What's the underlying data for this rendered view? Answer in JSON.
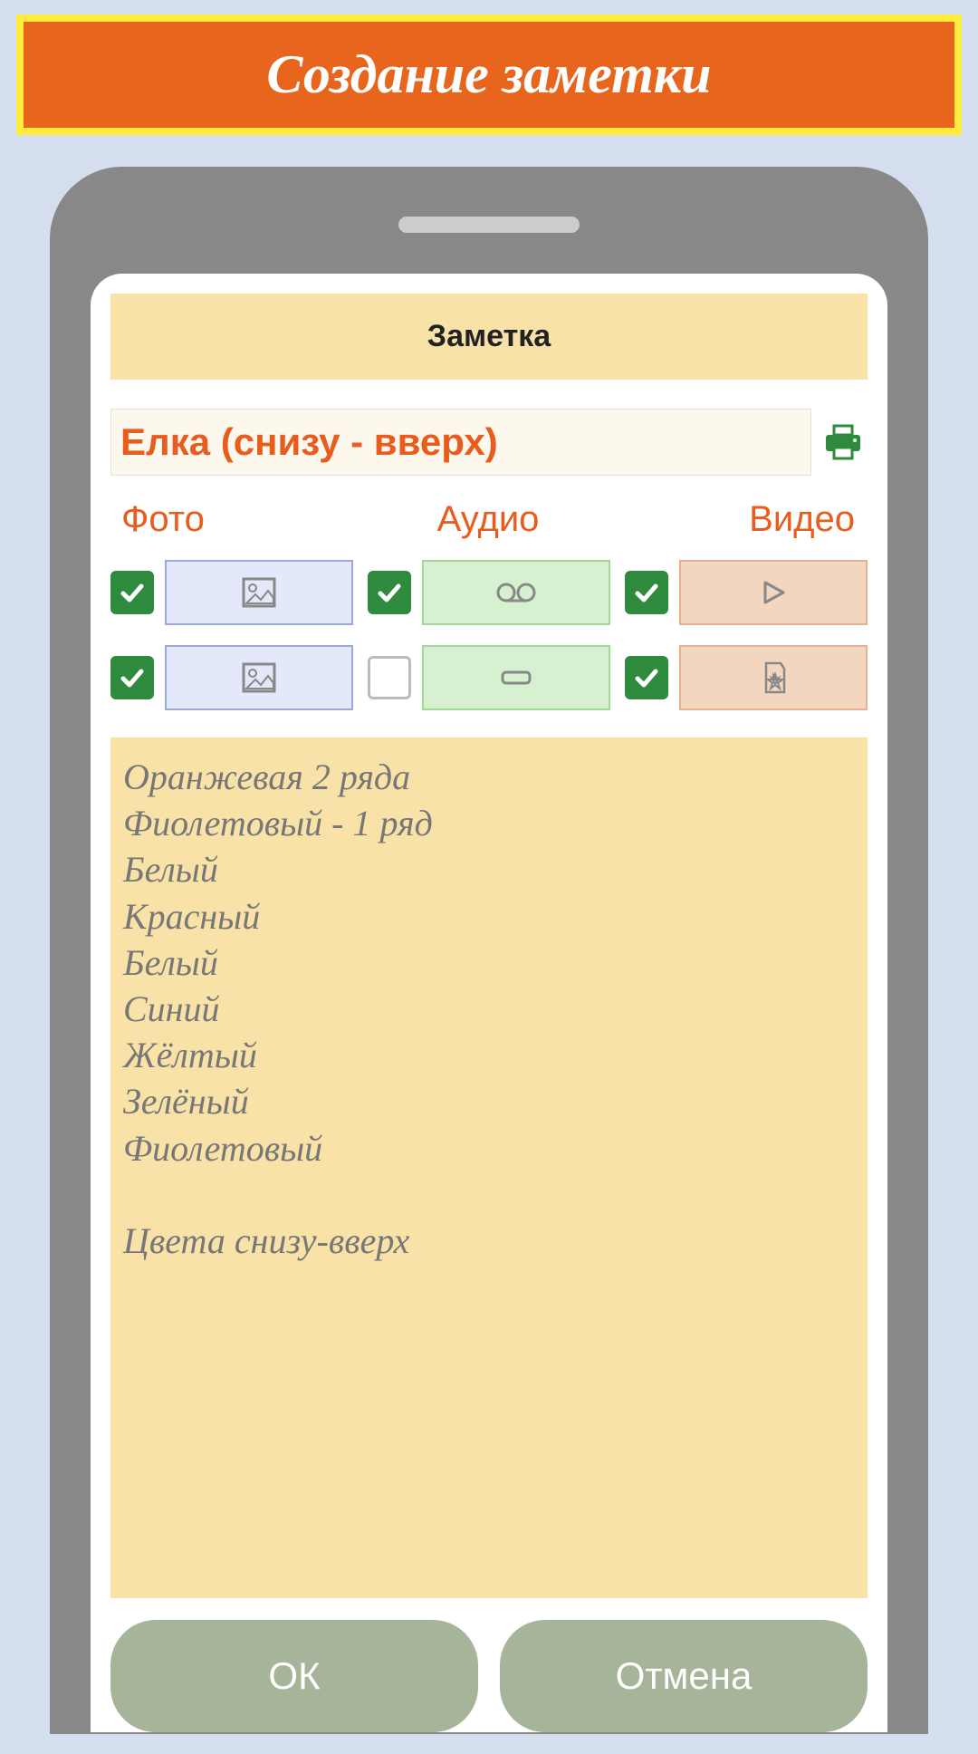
{
  "banner": {
    "title": "Создание заметки"
  },
  "header": {
    "title": "Заметка"
  },
  "note": {
    "title": "Елка (снизу - вверх)"
  },
  "media": {
    "photo_label": "Фото",
    "audio_label": "Аудио",
    "video_label": "Видео"
  },
  "body": {
    "text": "Оранжевая 2 ряда\nФиолетовый - 1 ряд\nБелый\nКрасный\nБелый\nСиний\nЖёлтый\nЗелёный\nФиолетовый\n\nЦвета снизу-вверх"
  },
  "actions": {
    "ok": "ОК",
    "cancel": "Отмена"
  }
}
